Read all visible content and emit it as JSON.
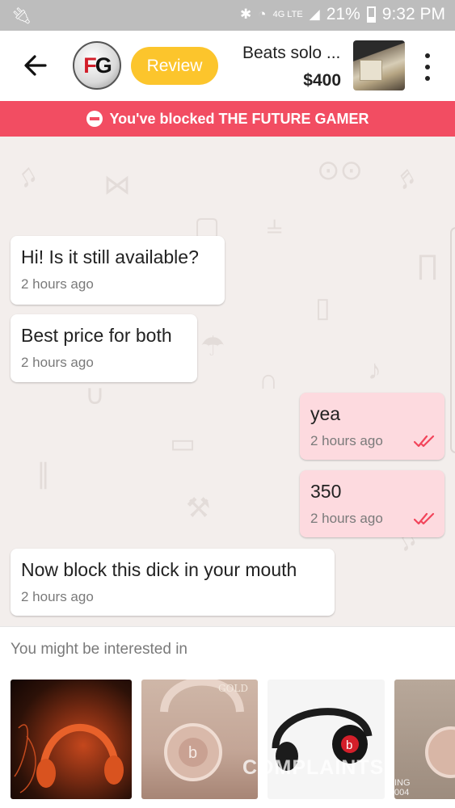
{
  "status_bar": {
    "battery": "21%",
    "time": "9:32 PM",
    "network": "4G LTE",
    "icons": [
      "usb-icon",
      "bluetooth-icon",
      "wifi-icon",
      "signal-icon",
      "battery-icon"
    ]
  },
  "header": {
    "back_icon": "arrow-left-icon",
    "avatar_text": {
      "f": "F",
      "g": "G"
    },
    "review_label": "Review",
    "product_title": "Beats solo ...",
    "product_price": "$400",
    "menu_icon": "more-vertical-icon"
  },
  "banner": {
    "text": "You've blocked THE FUTURE GAMER",
    "icon": "blocked-icon"
  },
  "messages": [
    {
      "direction": "in",
      "text": "Hi! Is it still available?",
      "time": "2 hours ago"
    },
    {
      "direction": "in",
      "text": "Best price for both",
      "time": "2 hours ago"
    },
    {
      "direction": "out",
      "text": "yea",
      "time": "2 hours ago",
      "status": "read"
    },
    {
      "direction": "out",
      "text": "350",
      "time": "2 hours ago",
      "status": "read"
    },
    {
      "direction": "in",
      "text": "Now block this dick in your mouth",
      "time": "2 hours ago"
    }
  ],
  "suggestions": {
    "title": "You might be interested in",
    "items": [
      {
        "label": "",
        "kind": "orange-headphones"
      },
      {
        "label": "GOLD",
        "kind": "rose-gold-beats-solo"
      },
      {
        "label": "",
        "kind": "black-beats-headphones"
      },
      {
        "label": "",
        "kind": "beats-box"
      }
    ]
  },
  "watermark": {
    "text": "COMPLAINTS",
    "sub": "ING\n004"
  },
  "colors": {
    "banner": "#f24d62",
    "review": "#fcc52c",
    "outgoing_bubble": "#fddadf",
    "read_ticks": "#f2455b",
    "status_bar": "#bdbdbd"
  }
}
